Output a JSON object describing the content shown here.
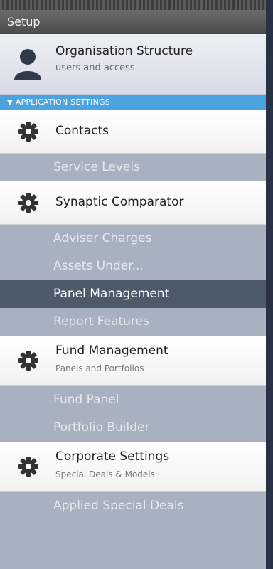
{
  "header": {
    "title": "Setup"
  },
  "org": {
    "title": "Organisation Structure",
    "subtitle": "users and access"
  },
  "section": {
    "title": "APPLICATION SETTINGS"
  },
  "items": [
    {
      "label": "Contacts"
    },
    {
      "label": "Service Levels"
    },
    {
      "label": "Synaptic Comparator"
    },
    {
      "label": "Adviser Charges"
    },
    {
      "label": "Assets Under..."
    },
    {
      "label": "Panel Management"
    },
    {
      "label": "Report Features"
    },
    {
      "label": "Fund Management",
      "sub": "Panels and Portfolios"
    },
    {
      "label": "Fund Panel"
    },
    {
      "label": "Portfolio Builder"
    },
    {
      "label": "Corporate Settings",
      "sub": "Special Deals & Models"
    },
    {
      "label": "Applied Special Deals"
    }
  ],
  "colors": {
    "section_bar": "#4aa3df",
    "active_item": "#4d5a6a",
    "sub_item_bg": "#a7b1bf"
  }
}
